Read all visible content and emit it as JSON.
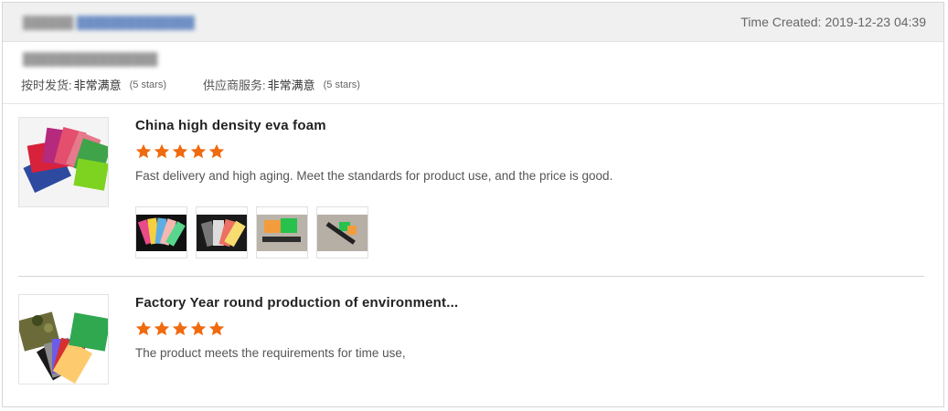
{
  "header": {
    "seller_name_blurred": "██████",
    "seller_link_blurred": "██████████████",
    "time_label": "Time Created:",
    "time_value": "2019-12-23 04:39"
  },
  "buyer": {
    "name_blurred": "████████████████"
  },
  "ratings": [
    {
      "label": "按时发货:",
      "value": "非常满意",
      "stars": "(5 stars)"
    },
    {
      "label": "供应商服务:",
      "value": "非常满意",
      "stars": "(5 stars)"
    }
  ],
  "products": [
    {
      "title": "China high density eva foam",
      "rating": 5,
      "review": "Fast delivery and high aging. Meet the standards for product use, and the price is good.",
      "photos": 4
    },
    {
      "title": "Factory Year round production of environment...",
      "rating": 5,
      "review": "The product meets the requirements for time use,",
      "photos": 0
    }
  ],
  "colors": {
    "star": "#f06a0f",
    "header_bg": "#f0f0f0",
    "border": "#d6d6d6"
  }
}
